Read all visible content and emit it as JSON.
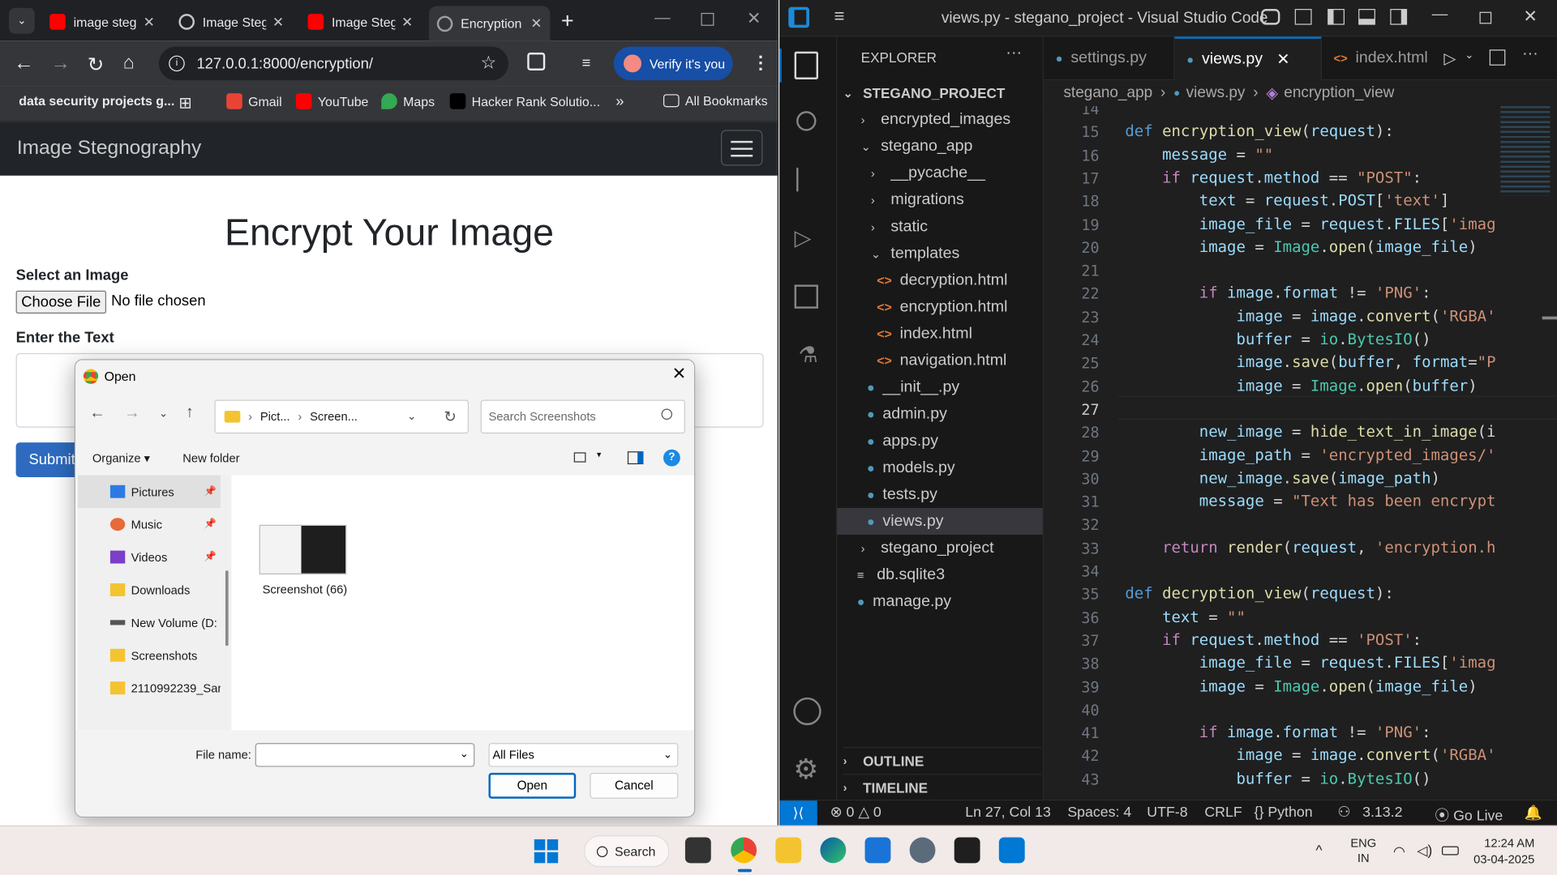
{
  "browser": {
    "tabs": [
      {
        "label": "image steg",
        "active": false
      },
      {
        "label": "Image Steg",
        "active": false
      },
      {
        "label": "Image Steg",
        "active": false
      },
      {
        "label": "Encryption",
        "active": true
      }
    ],
    "url": "127.0.0.1:8000/encryption/",
    "verify_label": "Verify it's you",
    "bookmarks": [
      "data security projects g...",
      "Gmail",
      "YouTube",
      "Maps",
      "Hacker Rank Solutio...",
      "All Bookmarks"
    ]
  },
  "page": {
    "brand": "Image Stegnography",
    "title": "Encrypt Your Image",
    "select_label": "Select an Image",
    "choose_file": "Choose File",
    "no_file": "No file chosen",
    "text_label": "Enter the Text",
    "submit": "Submit"
  },
  "dialog": {
    "title": "Open",
    "path": [
      "Pict...",
      "Screen..."
    ],
    "search_placeholder": "Search Screenshots",
    "organize": "Organize",
    "new_folder": "New folder",
    "nav_items": [
      "Pictures",
      "Music",
      "Videos",
      "Downloads",
      "New Volume (D:",
      "Screenshots",
      "2110992239_Sar"
    ],
    "file_item": "Screenshot (66)",
    "file_name_label": "File name:",
    "file_name_value": "",
    "file_type": "All Files",
    "open_btn": "Open",
    "cancel_btn": "Cancel"
  },
  "vscode": {
    "title": "views.py - stegano_project - Visual Studio Code",
    "explorer_label": "EXPLORER",
    "project": "STEGANO_PROJECT",
    "tree": [
      "encrypted_images",
      "stegano_app",
      "__pycache__",
      "migrations",
      "static",
      "templates",
      "decryption.html",
      "encryption.html",
      "index.html",
      "navigation.html",
      "__init__.py",
      "admin.py",
      "apps.py",
      "models.py",
      "tests.py",
      "views.py",
      "stegano_project",
      "db.sqlite3",
      "manage.py"
    ],
    "outline": "OUTLINE",
    "timeline": "TIMELINE",
    "tabs": [
      "settings.py",
      "views.py",
      "index.html"
    ],
    "breadcrumb": [
      "stegano_app",
      "views.py",
      "encryption_view"
    ],
    "line_numbers": [
      "14",
      "15",
      "16",
      "17",
      "18",
      "19",
      "20",
      "21",
      "22",
      "23",
      "24",
      "25",
      "26",
      "27",
      "28",
      "29",
      "30",
      "31",
      "32",
      "33",
      "34",
      "35",
      "36",
      "37",
      "38",
      "39",
      "40",
      "41",
      "42",
      "43"
    ],
    "status": {
      "problems": "0",
      "warnings": "0",
      "position": "Ln 27, Col 13",
      "spaces": "Spaces: 4",
      "encoding": "UTF-8",
      "eol": "CRLF",
      "language": "Python",
      "python_version": "3.13.2",
      "live": "Go Live"
    }
  },
  "taskbar": {
    "search": "Search",
    "lang": "ENG",
    "region": "IN",
    "time": "12:24 AM",
    "date": "03-04-2025"
  },
  "colors": {
    "vs_accent": "#0078d4",
    "chrome_bg": "#202124",
    "submit": "#2e6bc0"
  }
}
